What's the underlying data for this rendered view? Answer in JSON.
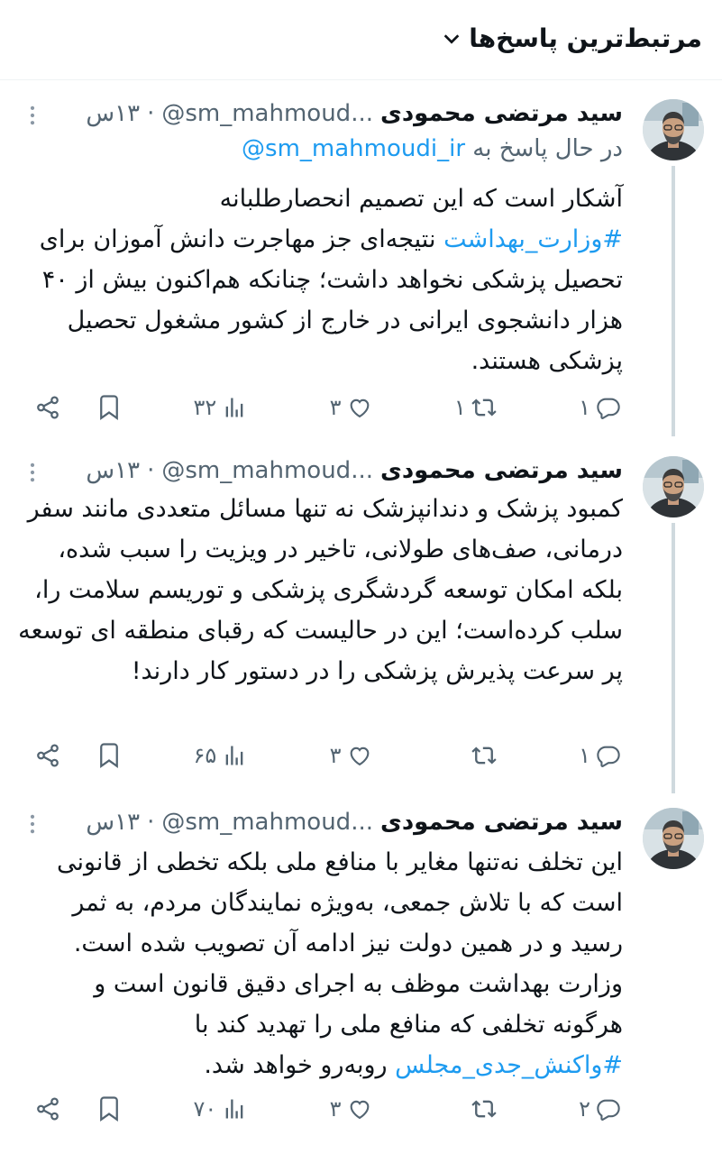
{
  "header": {
    "title": "مرتبط‌ترین پاسخ‌ها"
  },
  "tweets": [
    {
      "name": "سید مرتضی محمودی",
      "handle": "@sm_mahmoud...",
      "dot": "·",
      "time": "۱۳س",
      "replying_prefix": "در حال پاسخ به",
      "replying_handle": "@sm_mahmoudi_ir",
      "body_before": "آشکار است که این تصمیم انحصارطلبانه\n",
      "hashtag": "#وزارت_بهداشت",
      "body_after": " نتیجه‌ای جز مهاجرت دانش آموزان برای تحصیل پزشکی نخواهد داشت؛ چنانکه هم‌اکنون بیش از ۴۰ هزار دانشجوی ایرانی در خارج از کشور مشغول تحصیل پزشکی هستند.",
      "replies": "۱",
      "retweets": "۱",
      "likes": "۳",
      "views": "۳۲"
    },
    {
      "name": "سید مرتضی محمودی",
      "handle": "@sm_mahmoud...",
      "dot": "·",
      "time": "۱۳س",
      "body": "کمبود پزشک و دندانپزشک نه تنها مسائل متعددی مانند سفر درمانی، صف‌های طولانی، تاخیر در ویزیت را سبب شده، بلکه امکان توسعه گردشگری پزشکی و توریسم سلامت را، سلب کرده‌است؛ این در حالیست که رقبای منطقه ای  توسعه پر سرعت پذیرش پزشکی را در دستور کار دارند!",
      "replies": "۱",
      "retweets": "",
      "likes": "۳",
      "views": "۶۵"
    },
    {
      "name": "سید مرتضی محمودی",
      "handle": "@sm_mahmoud...",
      "dot": "·",
      "time": "۱۳س",
      "body_before": "این تخلف نه‌تنها مغایر با منافع ملی بلکه تخطی از قانونی است که با تلاش جمعی، به‌ویژه نمایندگان مردم، به ثمر رسید و در همین دولت نیز ادامه آن تصویب شده است.\nوزارت بهداشت موظف به اجرای دقیق قانون است و هرگونه تخلفی که منافع ملی را تهدید کند با\n",
      "hashtag": "#واکنش_جدی_مجلس",
      "body_after": " روبه‌رو خواهد شد.",
      "replies": "۲",
      "retweets": "",
      "likes": "۳",
      "views": "۷۰"
    }
  ],
  "icons": {
    "header": "chevron-down-icon",
    "more": "more-vertical-icon",
    "reply": "reply-icon",
    "retweet": "retweet-icon",
    "like": "heart-icon",
    "views": "views-icon",
    "bookmark": "bookmark-icon",
    "share": "share-icon"
  },
  "colors": {
    "link": "#1d9bf0",
    "muted": "#536471",
    "text": "#0f1419"
  }
}
